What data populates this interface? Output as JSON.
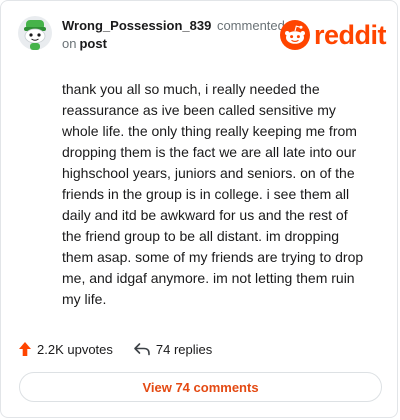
{
  "comment": {
    "username": "Wrong_Possession_839",
    "commented_text": "commented",
    "on_text": "on",
    "post_link": "post",
    "body": "thank you all so much, i really needed the\nreassurance as ive been called sensitive my\nwhole life. the only thing really keeping me from\ndropping them is the fact we are all late into our\nhighschool years, juniors and seniors. on of the\nfriends in the group is in college. i see them all\ndaily and itd be awkward for us and the rest of\nthe friend group to be all distant. im dropping\nthem asap. some of my friends are trying to drop\nme, and idgaf anymore. im not letting them ruin\nmy life."
  },
  "brand": {
    "logo_text": "reddit",
    "color": "#ff4500"
  },
  "actions": {
    "upvotes": "2.2K upvotes",
    "replies": "74 replies",
    "upvote_icon": "upvote-arrow-icon",
    "reply_icon": "reply-arrow-icon"
  },
  "view_comments": "View 74 comments"
}
